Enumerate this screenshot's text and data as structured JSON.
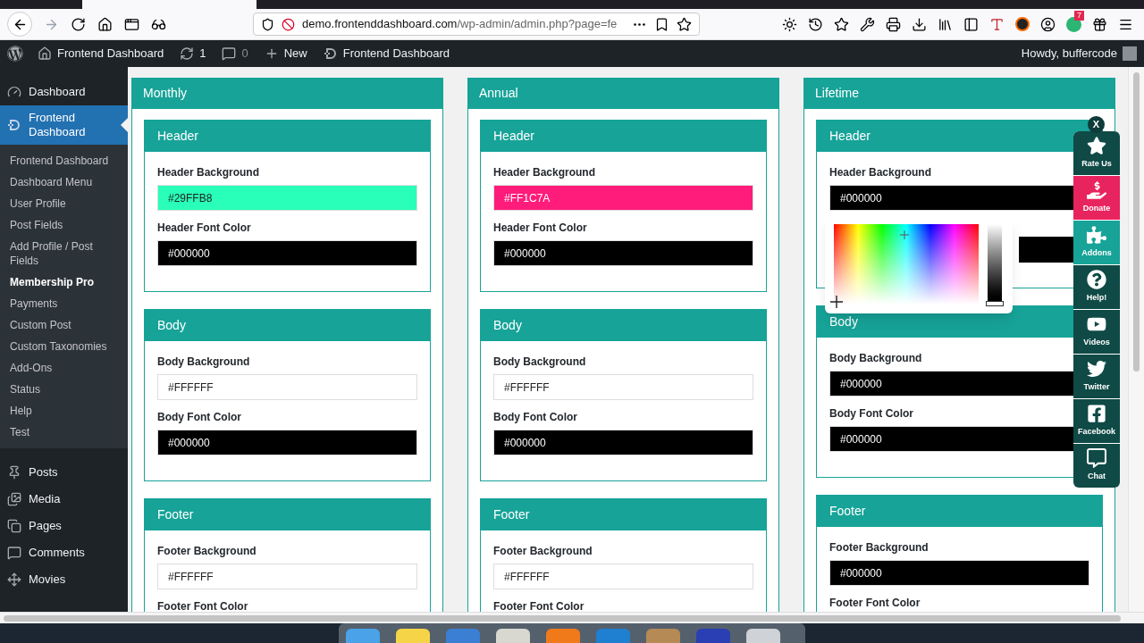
{
  "browser": {
    "host": "demo.frontenddashboard.com",
    "path": "/wp-admin/admin.php?page=fe",
    "badge": "7"
  },
  "admin_bar": {
    "items": [
      {
        "kind": "home",
        "label": "Frontend Dashboard"
      },
      {
        "kind": "updates",
        "label": "1"
      },
      {
        "kind": "comments",
        "label": "0"
      },
      {
        "kind": "new",
        "label": "New"
      },
      {
        "kind": "plugin",
        "label": "Frontend Dashboard"
      }
    ],
    "greeting": "Howdy, buffercode"
  },
  "sidebar": {
    "menu": [
      {
        "kind": "dashboard",
        "label": "Dashboard",
        "selected": false
      },
      {
        "kind": "plugin",
        "label": "Frontend Dashboard",
        "selected": true,
        "children": [
          {
            "label": "Frontend Dashboard",
            "selected": false
          },
          {
            "label": "Dashboard Menu",
            "selected": false
          },
          {
            "label": "User Profile",
            "selected": false
          },
          {
            "label": "Post Fields",
            "selected": false
          },
          {
            "label": "Add Profile / Post Fields",
            "selected": false
          },
          {
            "label": "Membership Pro",
            "selected": true
          },
          {
            "label": "Payments",
            "selected": false
          },
          {
            "label": "Custom Post",
            "selected": false
          },
          {
            "label": "Custom Taxonomies",
            "selected": false
          },
          {
            "label": "Add-Ons",
            "selected": false
          },
          {
            "label": "Status",
            "selected": false
          },
          {
            "label": "Help",
            "selected": false
          },
          {
            "label": "Test",
            "selected": false
          }
        ]
      },
      {
        "kind": "posts",
        "label": "Posts",
        "selected": false
      },
      {
        "kind": "media",
        "label": "Media",
        "selected": false
      },
      {
        "kind": "pages",
        "label": "Pages",
        "selected": false
      },
      {
        "kind": "comments",
        "label": "Comments",
        "selected": false
      },
      {
        "kind": "movies",
        "label": "Movies",
        "selected": false
      }
    ]
  },
  "plans": [
    {
      "title": "Monthly",
      "sections": [
        {
          "title": "Header",
          "fields": [
            {
              "label": "Header Background",
              "value": "#29FFB8",
              "color": "#29ffb8"
            },
            {
              "label": "Header Font Color",
              "value": "#000000",
              "color": "#000000"
            }
          ]
        },
        {
          "title": "Body",
          "fields": [
            {
              "label": "Body Background",
              "value": "#FFFFFF",
              "color": "#ffffff"
            },
            {
              "label": "Body Font Color",
              "value": "#000000",
              "color": "#000000"
            }
          ]
        },
        {
          "title": "Footer",
          "fields": [
            {
              "label": "Footer Background",
              "value": "#FFFFFF",
              "color": "#ffffff"
            },
            {
              "label": "Footer Font Color"
            }
          ]
        }
      ]
    },
    {
      "title": "Annual",
      "sections": [
        {
          "title": "Header",
          "fields": [
            {
              "label": "Header Background",
              "value": "#FF1C7A",
              "color": "#ff1c7a"
            },
            {
              "label": "Header Font Color",
              "value": "#000000",
              "color": "#000000"
            }
          ]
        },
        {
          "title": "Body",
          "fields": [
            {
              "label": "Body Background",
              "value": "#FFFFFF",
              "color": "#ffffff"
            },
            {
              "label": "Body Font Color",
              "value": "#000000",
              "color": "#000000"
            }
          ]
        },
        {
          "title": "Footer",
          "fields": [
            {
              "label": "Footer Background",
              "value": "#FFFFFF",
              "color": "#ffffff"
            },
            {
              "label": "Footer Font Color"
            }
          ]
        }
      ]
    },
    {
      "title": "Lifetime",
      "sections": [
        {
          "title": "Header",
          "fields": [
            {
              "label": "Header Background",
              "value": "#000000",
              "color": "#000000"
            },
            {
              "color": "#000000"
            }
          ]
        },
        {
          "title": "Body",
          "fields": [
            {
              "label": "Body Background",
              "value": "#000000",
              "color": "#000000"
            },
            {
              "label": "Body Font Color",
              "value": "#000000",
              "color": "#000000"
            }
          ]
        },
        {
          "title": "Footer",
          "fields": [
            {
              "label": "Footer Background",
              "value": "#000000",
              "color": "#000000"
            },
            {
              "label": "Footer Font Color"
            }
          ]
        }
      ]
    }
  ],
  "picker": {
    "level": 0
  },
  "side_panel": {
    "close": "X",
    "items": [
      {
        "kind": "star",
        "label": "Rate Us",
        "color": "#0f4a46"
      },
      {
        "kind": "donate",
        "label": "Donate",
        "color": "#e8245f"
      },
      {
        "kind": "puzzle",
        "label": "Addons",
        "color": "#17a398"
      },
      {
        "kind": "help",
        "label": "Help!",
        "color": "#0f4a46"
      },
      {
        "kind": "video",
        "label": "Videos",
        "color": "#0f4a46"
      },
      {
        "kind": "twitter",
        "label": "Twitter",
        "color": "#0f4a46"
      },
      {
        "kind": "facebook",
        "label": "Facebook",
        "color": "#0f4a46"
      },
      {
        "kind": "chat",
        "label": "Chat",
        "color": "#0f4a46"
      }
    ]
  }
}
